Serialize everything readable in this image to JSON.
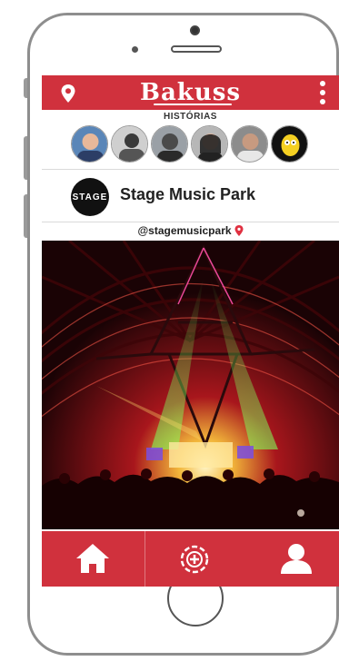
{
  "app": {
    "logo": "Bakuss"
  },
  "stories": {
    "label": "HISTÓRIAS",
    "items": [
      "story-1",
      "story-2",
      "story-3",
      "story-4",
      "story-5",
      "story-6"
    ]
  },
  "profile": {
    "avatar_text": "STAGE",
    "name": "Stage Music Park",
    "handle": "@stagemusicpark"
  },
  "nav": {
    "home": "home-icon",
    "add": "add-icon",
    "profile": "user-icon"
  },
  "colors": {
    "accent": "#d0313d",
    "text": "#222222"
  }
}
